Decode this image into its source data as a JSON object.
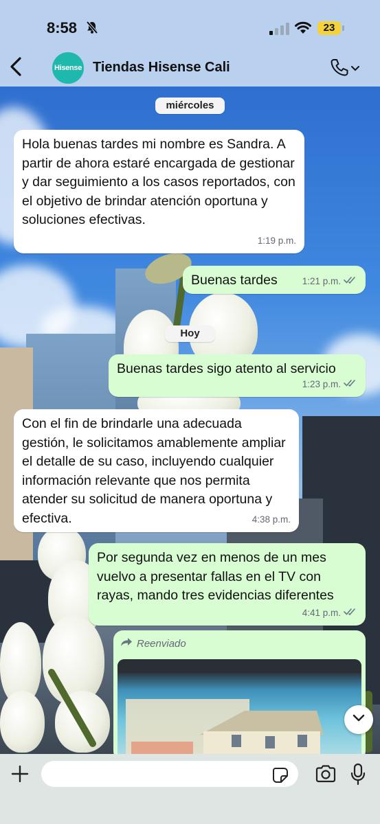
{
  "status_bar": {
    "time": "8:58",
    "battery": "23"
  },
  "header": {
    "contact_name": "Tiendas Hisense Cali",
    "avatar_text": "Hisense"
  },
  "chat": {
    "date_chips": [
      "miércoles",
      "Hoy"
    ],
    "messages": [
      {
        "direction": "incoming",
        "text": "Hola  buenas tardes mi nombre es Sandra. A partir de ahora estaré encargada de gestionar y dar seguimiento a los casos reportados, con el objetivo de brindar atención oportuna y soluciones efectivas.",
        "time": "1:19 p.m."
      },
      {
        "direction": "outgoing",
        "text": "Buenas tardes",
        "time": "1:21 p.m."
      },
      {
        "direction": "outgoing",
        "text": "Buenas tardes sigo atento al servicio",
        "time": "1:23 p.m."
      },
      {
        "direction": "incoming",
        "text": "Con el fin de brindarle una adecuada gestión, le solicitamos amablemente ampliar el detalle de su caso, incluyendo cualquier información relevante que nos permita atender su solicitud de manera oportuna y efectiva.",
        "time": "4:38 p.m."
      },
      {
        "direction": "outgoing",
        "text": "Por segunda vez en menos de un mes vuelvo a presentar fallas en el TV con rayas, mando tres evidencias diferentes",
        "time": "4:41 p.m."
      }
    ],
    "forwarded_label": "Reenviado"
  },
  "colors": {
    "outgoing_bubble": "#d9fdd3",
    "incoming_bubble": "#ffffff",
    "header_bg": "#b9d0ef",
    "read_ticks": "#667781",
    "battery": "#f3d23b"
  },
  "icons": [
    "back-icon",
    "phone-icon",
    "chevron-down-icon",
    "plus-icon",
    "sticker-icon",
    "camera-icon",
    "mic-icon",
    "forward-icon",
    "bell-muted-icon",
    "wifi-icon"
  ]
}
